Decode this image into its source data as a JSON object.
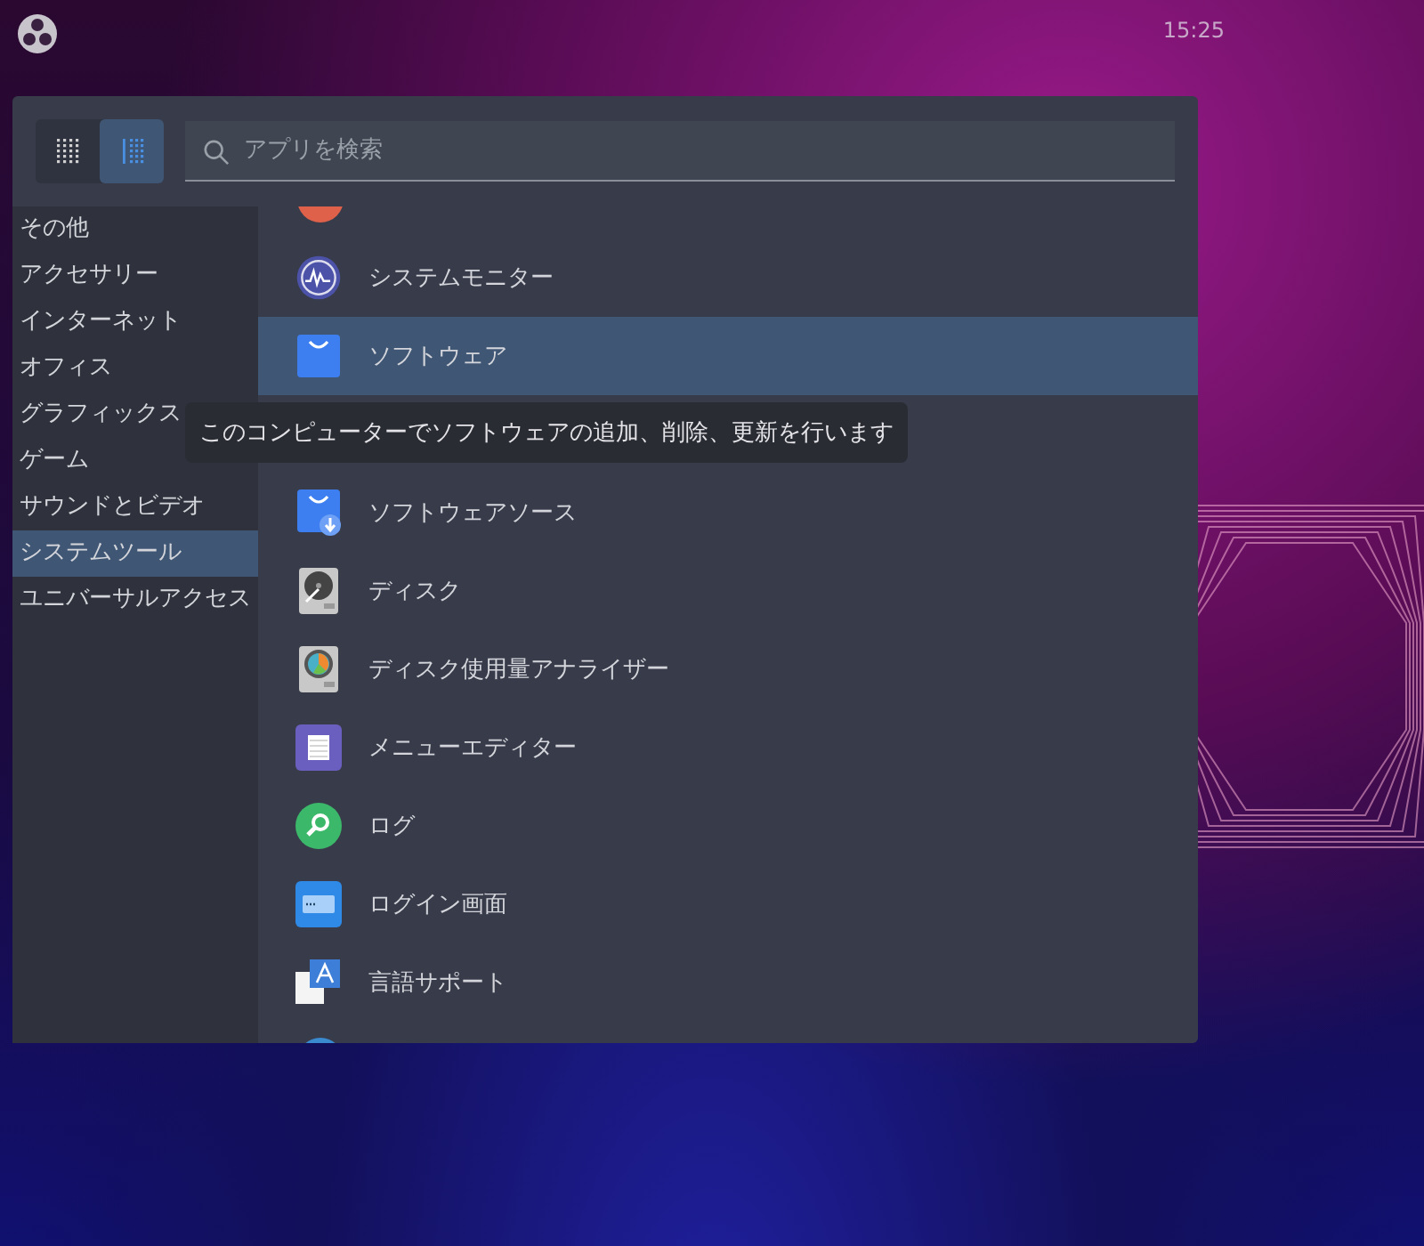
{
  "top_bar": {
    "clock": "15:25"
  },
  "menu": {
    "view_buttons": [
      {
        "kind": "grid",
        "selected": false
      },
      {
        "kind": "list",
        "selected": true
      }
    ],
    "search": {
      "placeholder": "アプリを検索"
    },
    "categories": [
      {
        "label": "その他",
        "selected": false
      },
      {
        "label": "アクセサリー",
        "selected": false
      },
      {
        "label": "インターネット",
        "selected": false
      },
      {
        "label": "オフィス",
        "selected": false
      },
      {
        "label": "グラフィックス",
        "selected": false
      },
      {
        "label": "ゲーム",
        "selected": false
      },
      {
        "label": "サウンドとビデオ",
        "selected": false
      },
      {
        "label": "システムツール",
        "selected": true
      },
      {
        "label": "ユニバーサルアクセス",
        "selected": false
      }
    ],
    "apps": [
      {
        "label": "システムモニター",
        "kind": "monitor",
        "selected": false
      },
      {
        "label": "ソフトウェア",
        "kind": "software",
        "selected": true
      },
      {
        "label": "ソフトウェアソース",
        "kind": "software-sources",
        "selected": false
      },
      {
        "label": "ディスク",
        "kind": "disk",
        "selected": false
      },
      {
        "label": "ディスク使用量アナライザー",
        "kind": "disk-usage",
        "selected": false
      },
      {
        "label": "メニューエディター",
        "kind": "menu-editor",
        "selected": false
      },
      {
        "label": "ログ",
        "kind": "logs",
        "selected": false
      },
      {
        "label": "ログイン画面",
        "kind": "login",
        "selected": false
      },
      {
        "label": "言語サポート",
        "kind": "language",
        "selected": false
      }
    ],
    "tooltip": "このコンピューターでソフトウェアの追加、削除、更新を行います"
  }
}
